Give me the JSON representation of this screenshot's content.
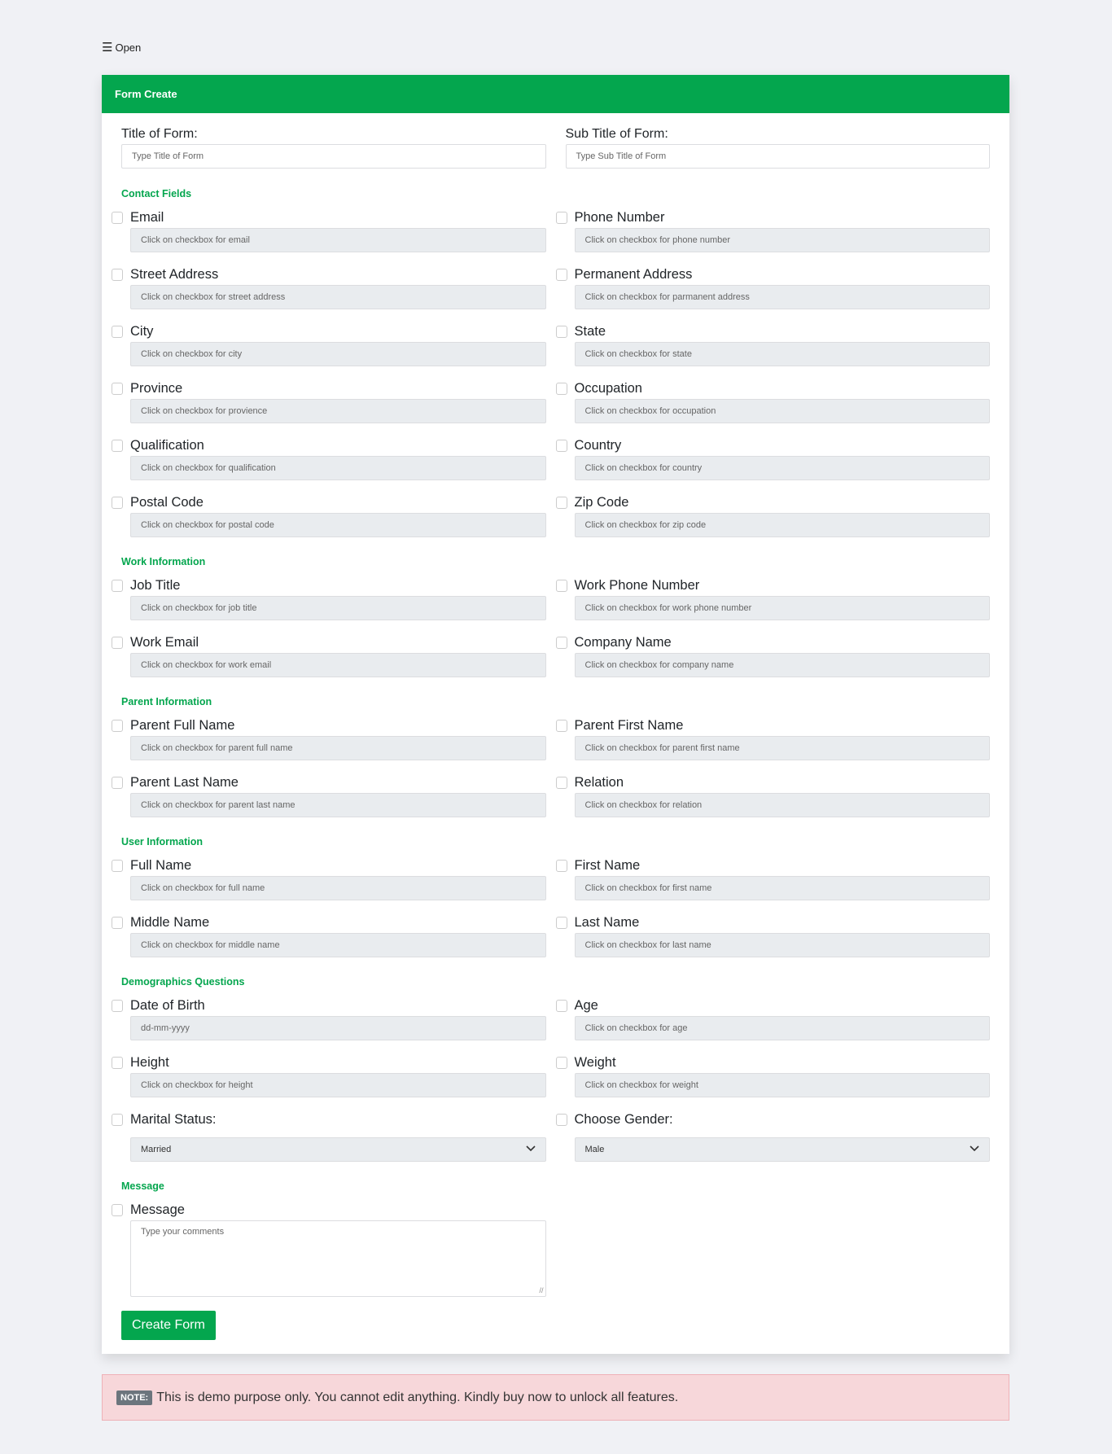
{
  "nav": {
    "open_label": "Open"
  },
  "card": {
    "title": "Form Create"
  },
  "title_field": {
    "label": "Title of Form:",
    "placeholder": "Type Title of Form"
  },
  "subtitle_field": {
    "label": "Sub Title of Form:",
    "placeholder": "Type Sub Title of Form"
  },
  "sections": [
    {
      "title": "Contact Fields",
      "fields": [
        {
          "label": "Email",
          "placeholder": "Click on checkbox for email"
        },
        {
          "label": "Phone Number",
          "placeholder": "Click on checkbox for phone number"
        },
        {
          "label": "Street Address",
          "placeholder": "Click on checkbox for street address"
        },
        {
          "label": "Permanent Address",
          "placeholder": "Click on checkbox for parmanent address"
        },
        {
          "label": "City",
          "placeholder": "Click on checkbox for city"
        },
        {
          "label": "State",
          "placeholder": "Click on checkbox for state"
        },
        {
          "label": "Province",
          "placeholder": "Click on checkbox for provience"
        },
        {
          "label": "Occupation",
          "placeholder": "Click on checkbox for occupation"
        },
        {
          "label": "Qualification",
          "placeholder": "Click on checkbox for qualification"
        },
        {
          "label": "Country",
          "placeholder": "Click on checkbox for country"
        },
        {
          "label": "Postal Code",
          "placeholder": "Click on checkbox for postal code"
        },
        {
          "label": "Zip Code",
          "placeholder": "Click on checkbox for zip code"
        }
      ]
    },
    {
      "title": "Work Information",
      "fields": [
        {
          "label": "Job Title",
          "placeholder": "Click on checkbox for job title"
        },
        {
          "label": "Work Phone Number",
          "placeholder": "Click on checkbox for work phone number"
        },
        {
          "label": "Work Email",
          "placeholder": "Click on checkbox for work email"
        },
        {
          "label": "Company Name",
          "placeholder": "Click on checkbox for company name"
        }
      ]
    },
    {
      "title": "Parent Information",
      "fields": [
        {
          "label": "Parent Full Name",
          "placeholder": "Click on checkbox for parent full name"
        },
        {
          "label": "Parent First Name",
          "placeholder": "Click on checkbox for parent first name"
        },
        {
          "label": "Parent Last Name",
          "placeholder": "Click on checkbox for parent last name"
        },
        {
          "label": "Relation",
          "placeholder": "Click on checkbox for relation"
        }
      ]
    },
    {
      "title": "User Information",
      "fields": [
        {
          "label": "Full Name",
          "placeholder": "Click on checkbox for full name"
        },
        {
          "label": "First Name",
          "placeholder": "Click on checkbox for first name"
        },
        {
          "label": "Middle Name",
          "placeholder": "Click on checkbox for middle name"
        },
        {
          "label": "Last Name",
          "placeholder": "Click on checkbox for last name"
        }
      ]
    },
    {
      "title": "Demographics Questions",
      "fields": [
        {
          "label": "Date of Birth",
          "placeholder": "dd-mm-yyyy"
        },
        {
          "label": "Age",
          "placeholder": "Click on checkbox for age"
        },
        {
          "label": "Height",
          "placeholder": "Click on checkbox for height"
        },
        {
          "label": "Weight",
          "placeholder": "Click on checkbox for weight"
        },
        {
          "label": "Marital Status:",
          "select": "Married"
        },
        {
          "label": "Choose Gender:",
          "select": "Male"
        }
      ]
    },
    {
      "title": "Message",
      "fields": [
        {
          "label": "Message",
          "textarea": "Type your comments"
        }
      ]
    }
  ],
  "submit_label": "Create Form",
  "note": {
    "badge": "NOTE:",
    "text": "This is demo purpose only. You cannot edit anything. Kindly buy now to unlock all features."
  }
}
